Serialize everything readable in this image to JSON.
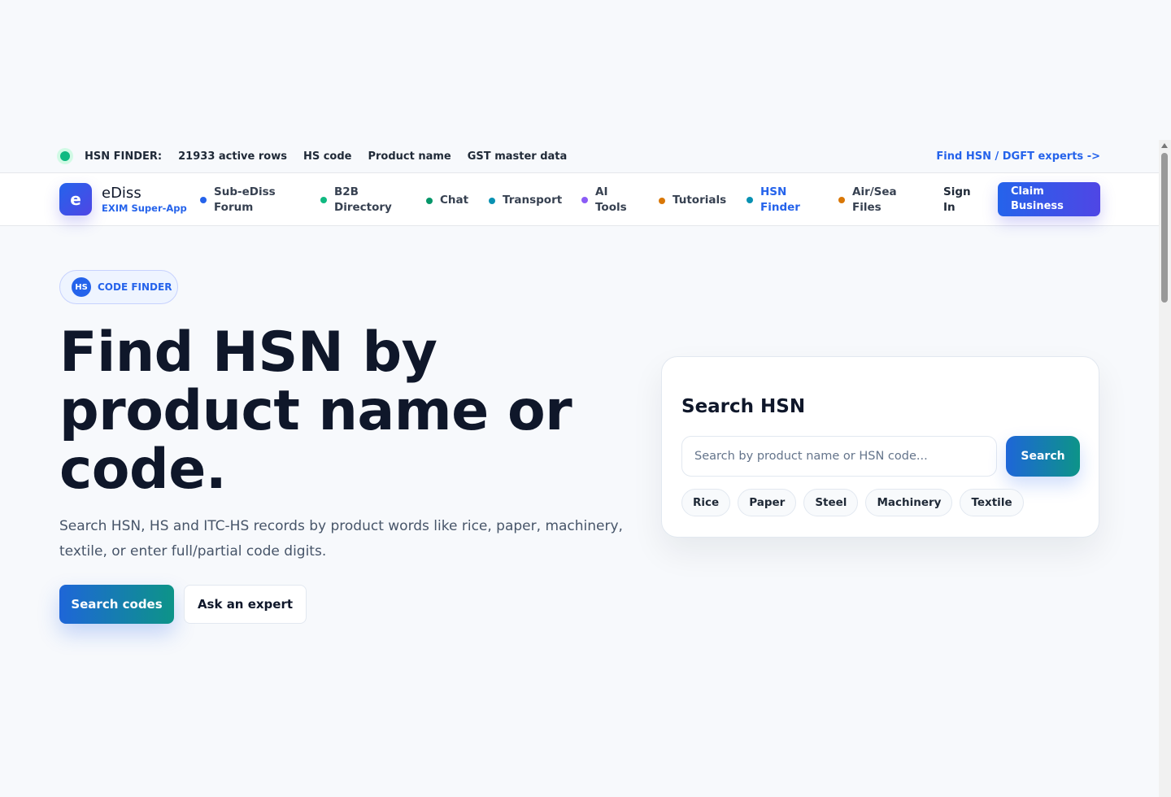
{
  "topstrip": {
    "label": "HSN FINDER:",
    "items": [
      "21933 active rows",
      "HS code",
      "Product name",
      "GST master data"
    ],
    "link": "Find HSN / DGFT experts ->"
  },
  "brand": {
    "logo_letter": "e",
    "name": "eDiss",
    "tagline": "EXIM Super-App"
  },
  "nav": {
    "items": [
      {
        "label": "Sub-eDiss Forum",
        "dot_color": "#2563eb"
      },
      {
        "label": "B2B Directory",
        "dot_color": "#10b981"
      },
      {
        "label": "Chat",
        "dot_color": "#059669"
      },
      {
        "label": "Transport",
        "dot_color": "#0891b2"
      },
      {
        "label": "AI Tools",
        "dot_color": "#8b5cf6"
      },
      {
        "label": "Tutorials",
        "dot_color": "#d97706"
      },
      {
        "label": "HSN Finder",
        "dot_color": "#0891b2",
        "active": true
      },
      {
        "label": "Air/Sea Files",
        "dot_color": "#d97706"
      }
    ],
    "signin": "Sign In",
    "claim": "Claim Business"
  },
  "hero": {
    "badge_icon": "HS",
    "badge_label": "CODE FINDER",
    "title": "Find HSN by product name or code.",
    "description": "Search HSN, HS and ITC-HS records by product words like rice, paper, machinery, textile, or enter full/partial code digits.",
    "primary_button": "Search codes",
    "secondary_button": "Ask an expert"
  },
  "search_card": {
    "title": "Search HSN",
    "placeholder": "Search by product name or HSN code...",
    "button": "Search",
    "chips": [
      "Rice",
      "Paper",
      "Steel",
      "Machinery",
      "Textile"
    ]
  },
  "colors": {
    "accent": "#2563eb",
    "accent_secondary": "#4f46e5",
    "teal": "#0d9488",
    "live_dot": "#10b981"
  }
}
